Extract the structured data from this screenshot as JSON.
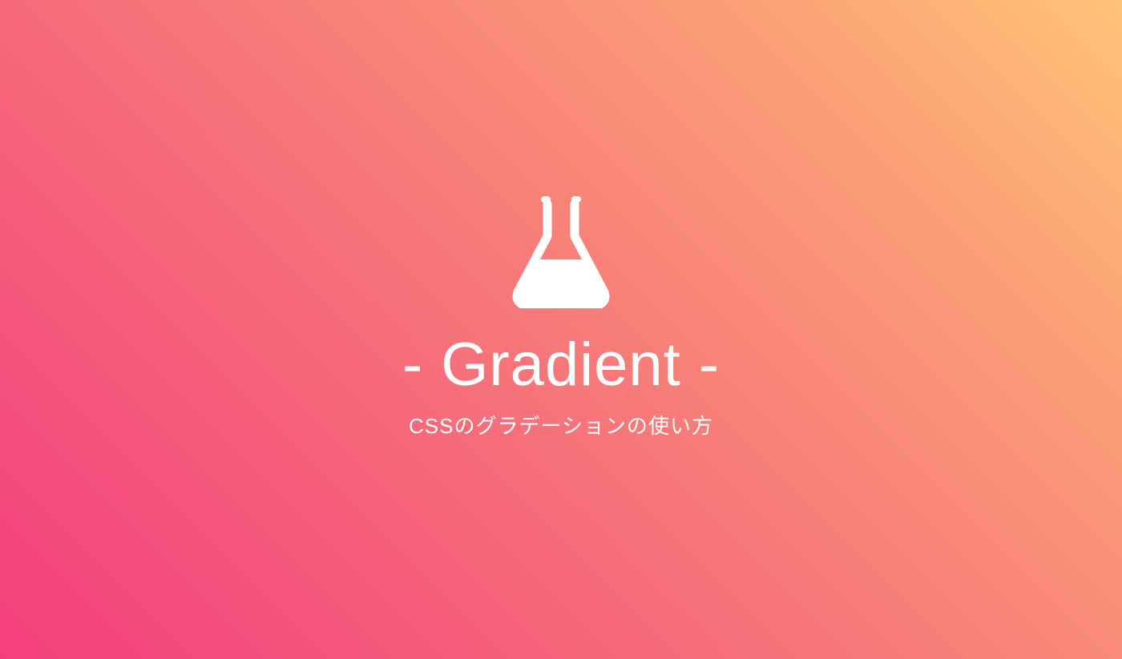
{
  "title": "- Gradient -",
  "subtitle": "CSSのグラデーションの使い方",
  "icon": "flask-icon",
  "colors": {
    "text": "#ffffff",
    "gradient_start": "#ffc478",
    "gradient_end": "#f3407d"
  }
}
